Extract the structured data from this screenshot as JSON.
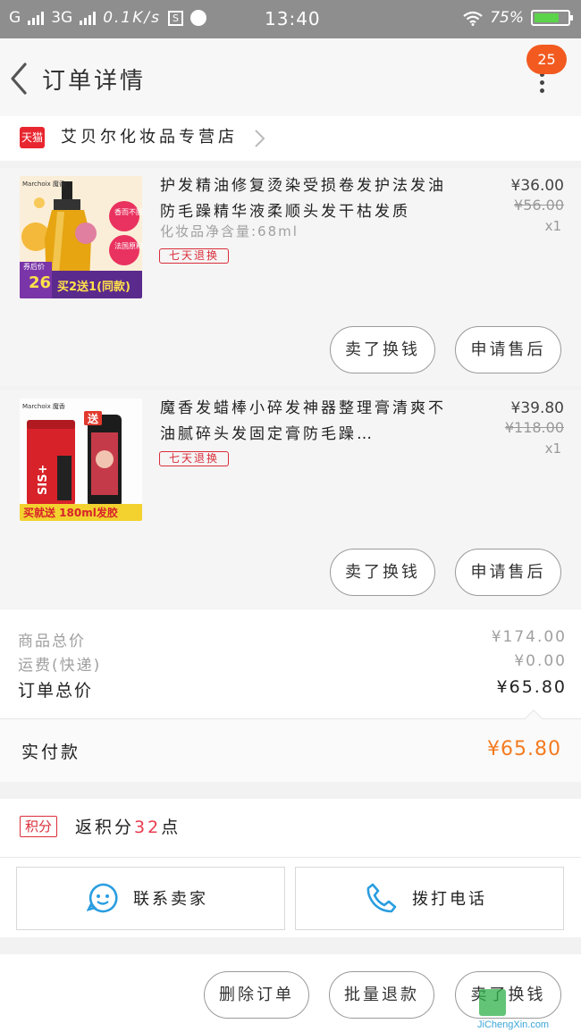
{
  "status_bar": {
    "network_g": "G",
    "network_3g": "3G",
    "speed": "0.1K/s",
    "s_icon_label": "S",
    "time": "13:40",
    "battery": "75%",
    "battery_level": 0.75
  },
  "header": {
    "title": "订单详情",
    "badge_count": "25"
  },
  "shop": {
    "badge": "天猫",
    "name": "艾贝尔化妆品专营店"
  },
  "items": [
    {
      "title": "护发精油修复烫染受损卷发护法发油防毛躁精华液柔顺头发干枯发质",
      "spec": "化妆品净含量:68ml",
      "tag": "七天退换",
      "price": "¥36.00",
      "old_price": "¥56.00",
      "qty": "x1",
      "btn_exchange": "卖了换钱",
      "btn_aftersale": "申请售后",
      "thumb": {
        "brand": "Marchoix 魔香",
        "badge1": "香而不腻",
        "badge2": "法国原料",
        "coupon_label": "券后价",
        "coupon_price": "26",
        "promo": "买2送1(同款)"
      }
    },
    {
      "title": "魔香发蜡棒小碎发神器整理膏清爽不油腻碎头发固定膏防毛躁…",
      "tag": "七天退换",
      "price": "¥39.80",
      "old_price": "¥118.00",
      "qty": "x1",
      "btn_exchange": "卖了换钱",
      "btn_aftersale": "申请售后",
      "thumb": {
        "brand": "Marchoix 魔香",
        "gift_tag": "送",
        "can_text": "SIS+",
        "promo": "买就送 180ml发胶"
      }
    }
  ],
  "summary": {
    "goods_total_label": "商品总价",
    "goods_total_value": "¥174.00",
    "shipping_label": "运费(快递)",
    "shipping_value": "¥0.00",
    "order_total_label": "订单总价",
    "order_total_value": "¥65.80"
  },
  "paid": {
    "label": "实付款",
    "value": "¥65.80"
  },
  "points": {
    "tag": "积分",
    "prefix": "返积分",
    "amount": "32",
    "suffix": "点"
  },
  "contact": {
    "seller": "联系卖家",
    "phone": "拨打电话"
  },
  "bottom_bar": {
    "delete_order": "删除订单",
    "batch_refund": "批量退款",
    "sell_exchange": "卖了换钱"
  },
  "watermark": {
    "site": "JiChengXin.com"
  },
  "colors": {
    "accent_orange": "#f47b20",
    "tmall_red": "#e8262f",
    "tag_red": "#d92e3a",
    "contact_blue": "#2a9de0"
  }
}
